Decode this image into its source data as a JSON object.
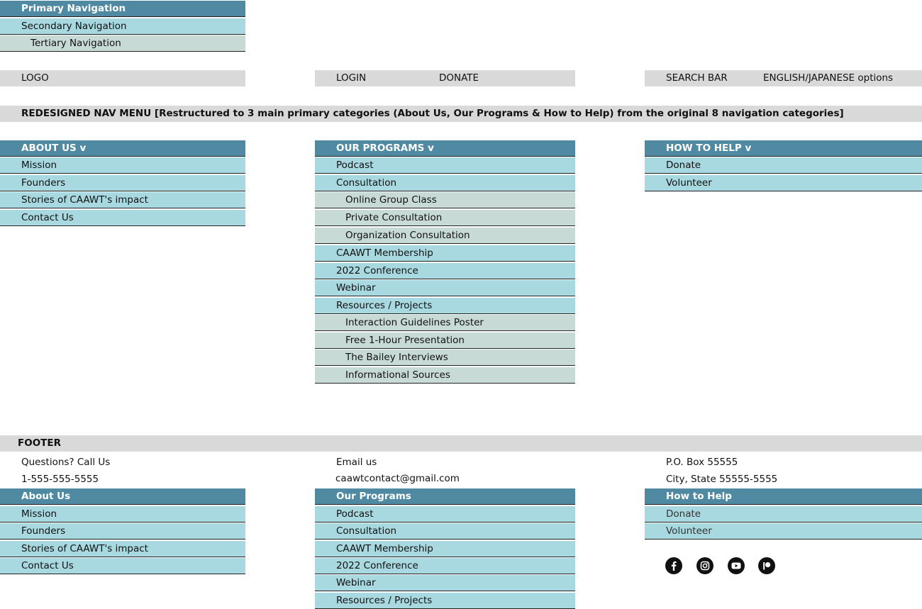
{
  "legend": {
    "primary": "Primary Navigation",
    "secondary": "Secondary Navigation",
    "tertiary": "Tertiary Navigation"
  },
  "header": {
    "logo": "LOGO",
    "login": "LOGIN",
    "donate": "DONATE",
    "search": "SEARCH BAR",
    "language": "ENGLISH/JAPANESE options"
  },
  "redesign_title": "REDESIGNED NAV MENU [Restructured to 3 main primary categories (About Us, Our Programs & How to Help) from the original 8 navigation categories]",
  "nav": {
    "about": {
      "title": "ABOUT US v",
      "items": [
        "Mission",
        "Founders",
        "Stories of CAAWT's impact",
        "Contact Us"
      ]
    },
    "programs": {
      "title": "OUR PROGRAMS v",
      "items": [
        "Podcast",
        "Consultation",
        "Online Group Class",
        "Private Consultation",
        "Organization Consultation",
        "CAAWT Membership",
        "2022 Conference",
        "Webinar",
        "Resources / Projects",
        "Interaction Guidelines Poster",
        "Free 1-Hour Presentation",
        "The Bailey Interviews",
        "Informational Sources"
      ]
    },
    "help": {
      "title": "HOW TO HELP v",
      "items": [
        "Donate",
        "Volunteer"
      ]
    }
  },
  "footer": {
    "title": "FOOTER",
    "call_label": "Questions? Call Us",
    "phone": "1-555-555-5555",
    "email_label": "Email us",
    "email": "caawtcontact@gmail.com",
    "po_box": "P.O. Box 55555",
    "city": "City, State 55555-5555",
    "about": {
      "title": "About Us",
      "items": [
        "Mission",
        "Founders",
        "Stories of CAAWT's impact",
        "Contact Us"
      ]
    },
    "programs": {
      "title": "Our Programs",
      "items": [
        "Podcast",
        "Consultation",
        "CAAWT Membership",
        "2022 Conference",
        "Webinar",
        "Resources / Projects"
      ]
    },
    "help": {
      "title": "How to Help",
      "items": [
        "Donate",
        "Volunteer"
      ]
    },
    "social_icons": [
      "facebook-icon",
      "instagram-icon",
      "youtube-icon",
      "patreon-icon"
    ]
  }
}
